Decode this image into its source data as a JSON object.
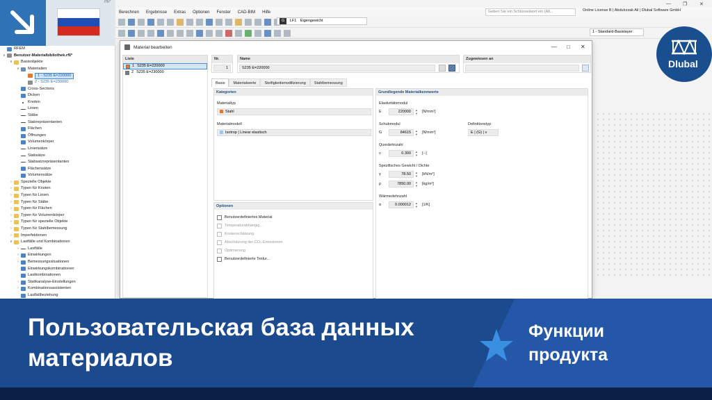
{
  "app": {
    "title_fragment": "rf6*",
    "menu": [
      "Berechnen",
      "Ergebnisse",
      "Extras",
      "Optionen",
      "Fenster",
      "CAD-BIM",
      "Hilfe"
    ],
    "search_placeholder": "Geben Sie ein Schlüsselwort ein (Alt...",
    "license": "Online License B | Abdulrzzak Ali | Dlubal Software GmbH",
    "loadcase_tag": "G",
    "loadcase_id": "LF1",
    "loadcase_name": "Eigengewicht",
    "basislayer": "1 - Standard-Basislayer"
  },
  "navigator": {
    "items": [
      {
        "label": "RFEM",
        "level": 0,
        "chev": "",
        "icon": "blue"
      },
      {
        "label": "Benutzer-Materialbibliothek.rf6*",
        "level": 0,
        "chev": "v",
        "icon": "gray",
        "bold": true
      },
      {
        "label": "Basisobjekte",
        "level": 1,
        "chev": "v",
        "icon": "folder"
      },
      {
        "label": "Materialien",
        "level": 2,
        "chev": "v",
        "icon": "mat"
      },
      {
        "label": "1 - S235 E=220000",
        "level": 3,
        "chev": "",
        "icon": "orange",
        "selected": true
      },
      {
        "label": "2 - S235 E=230000",
        "level": 3,
        "chev": "",
        "icon": "gray",
        "blue": true
      },
      {
        "label": "Cross-Sections",
        "level": 2,
        "chev": "",
        "icon": "blue"
      },
      {
        "label": "Dicken",
        "level": 2,
        "chev": "",
        "icon": "blue"
      },
      {
        "label": "Knoten",
        "level": 2,
        "chev": "",
        "icon": "pt"
      },
      {
        "label": "Linien",
        "level": 2,
        "chev": "",
        "icon": "line"
      },
      {
        "label": "Stäbe",
        "level": 2,
        "chev": "",
        "icon": "line"
      },
      {
        "label": "Stabrepräsentanten",
        "level": 2,
        "chev": "",
        "icon": "line"
      },
      {
        "label": "Flächen",
        "level": 2,
        "chev": "",
        "icon": "blue"
      },
      {
        "label": "Öffnungen",
        "level": 2,
        "chev": "",
        "icon": "blue"
      },
      {
        "label": "Volumenkörper",
        "level": 2,
        "chev": "",
        "icon": "blue"
      },
      {
        "label": "Liniensätze",
        "level": 2,
        "chev": "",
        "icon": "line"
      },
      {
        "label": "Stabsätze",
        "level": 2,
        "chev": "",
        "icon": "line"
      },
      {
        "label": "Stabsatzrepräsentanten",
        "level": 2,
        "chev": "",
        "icon": "line"
      },
      {
        "label": "Flächensätze",
        "level": 2,
        "chev": "",
        "icon": "blue"
      },
      {
        "label": "Volumensätze",
        "level": 2,
        "chev": "",
        "icon": "blue"
      },
      {
        "label": "Spezielle Objekte",
        "level": 1,
        "chev": ">",
        "icon": "folder"
      },
      {
        "label": "Typen für Knoten",
        "level": 1,
        "chev": ">",
        "icon": "folder"
      },
      {
        "label": "Typen für Linien",
        "level": 1,
        "chev": ">",
        "icon": "folder"
      },
      {
        "label": "Typen für Stäbe",
        "level": 1,
        "chev": ">",
        "icon": "folder"
      },
      {
        "label": "Typen für Flächen",
        "level": 1,
        "chev": ">",
        "icon": "folder"
      },
      {
        "label": "Typen für Volumenkörper",
        "level": 1,
        "chev": ">",
        "icon": "folder"
      },
      {
        "label": "Typen für spezielle Objekte",
        "level": 1,
        "chev": ">",
        "icon": "folder"
      },
      {
        "label": "Typen für Stahlbemessung",
        "level": 1,
        "chev": ">",
        "icon": "folder"
      },
      {
        "label": "Imperfektionen",
        "level": 1,
        "chev": ">",
        "icon": "folder"
      },
      {
        "label": "Lastfälle und Kombinationen",
        "level": 1,
        "chev": "v",
        "icon": "folder"
      },
      {
        "label": "Lastfälle",
        "level": 2,
        "chev": ">",
        "icon": "line"
      },
      {
        "label": "Einwirkungen",
        "level": 2,
        "chev": ">",
        "icon": "blue"
      },
      {
        "label": "Bemessungssituationen",
        "level": 2,
        "chev": ">",
        "icon": "blue"
      },
      {
        "label": "Einwirkungskombinationen",
        "level": 2,
        "chev": "",
        "icon": "blue"
      },
      {
        "label": "Lastkombinationen",
        "level": 2,
        "chev": "",
        "icon": "blue"
      },
      {
        "label": "Statikanalyse-Einstellungen",
        "level": 2,
        "chev": ">",
        "icon": "blue"
      },
      {
        "label": "Kombinationsassistenten",
        "level": 2,
        "chev": ">",
        "icon": "blue"
      },
      {
        "label": "Lastfallbeziehung",
        "level": 2,
        "chev": "",
        "icon": "blue"
      }
    ]
  },
  "dialog": {
    "title": "Material bearbeiten",
    "list_header": "Liste",
    "list": [
      {
        "no": "1",
        "name": "S235 E=220000",
        "color": "#e07a30"
      },
      {
        "no": "2",
        "name": "S235 E=230000",
        "color": "#7a7a7a"
      }
    ],
    "no_header": "Nr.",
    "no_value": "1",
    "name_header": "Name",
    "name_value": "S235 E=220000",
    "assigned_header": "Zugewiesen an",
    "tabs": [
      "Basis",
      "Materialwerte",
      "Steifigkeitsmodifizierung",
      "Stahlbemessung"
    ],
    "categories": {
      "header": "Kategorien",
      "material_type_label": "Materialtyp",
      "material_type_value": "Stahl",
      "material_model_label": "Materialmodell",
      "material_model_value": "Isotrop | Linear elastisch"
    },
    "options": {
      "header": "Optionen",
      "items": [
        {
          "label": "Benutzerdefiniertes Material",
          "disabled": false
        },
        {
          "label": "Temperaturabhängig...",
          "disabled": true
        },
        {
          "label": "Kostenschätzung",
          "disabled": true
        },
        {
          "label": "Abschätzung der CO₂-Emissionen",
          "disabled": true
        },
        {
          "label": "Optimierung",
          "disabled": true
        },
        {
          "label": "Benutzerdefinierte Textur...",
          "disabled": false
        }
      ]
    },
    "basic_values": {
      "header": "Grundlegende Materialkennwerte",
      "e_section": "Elastizitätsmodul",
      "e_symbol": "E",
      "e_value": "220000",
      "e_unit": "[N/mm²]",
      "g_section": "Schubmodul",
      "g_symbol": "G",
      "g_value": "84615",
      "g_unit": "[N/mm²]",
      "def_type_label": "Definitionstyp",
      "def_type_value": "E | (G) | ν",
      "nu_section": "Querdehnzahl",
      "nu_symbol": "ν",
      "nu_value": "0.300",
      "nu_unit": "[--]",
      "weight_section": "Spezifisches Gewicht / Dichte",
      "gamma_symbol": "γ",
      "gamma_value": "78.50",
      "gamma_unit": "[kN/m³]",
      "rho_symbol": "ρ",
      "rho_value": "7850.00",
      "rho_unit": "[kg/m³]",
      "alpha_section": "Wärmedehnzahl",
      "alpha_symbol": "α",
      "alpha_value": "0.000012",
      "alpha_unit": "[1/K]"
    }
  },
  "logo": {
    "text": "Dlubal"
  },
  "banner": {
    "title": "Пользовательская база данных материалов",
    "subtitle": "Функции продукта"
  },
  "colors": {
    "accent_blue": "#1c4a8f",
    "banner_dark": "#0b1f47",
    "corner_blue": "#2f73b6",
    "star": "#3b8fe0",
    "material_orange": "#e07a30"
  }
}
